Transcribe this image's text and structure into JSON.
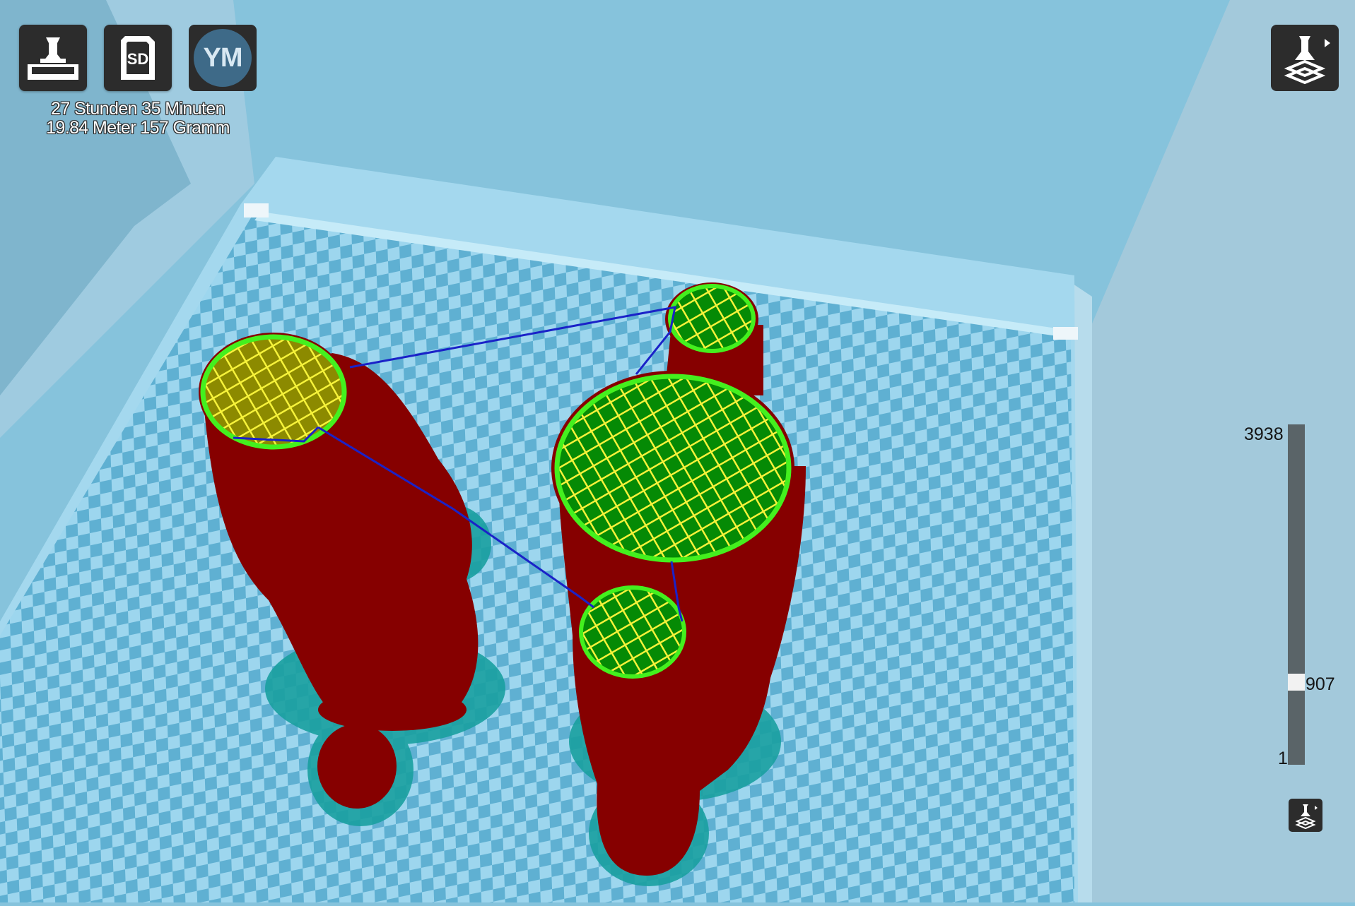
{
  "toolbar": {
    "open_file_icon": "printer-tray-icon",
    "sd_card": {
      "icon": "sd-card-icon",
      "label": "SD"
    },
    "account": {
      "initials": "YM"
    }
  },
  "print_info": {
    "duration": "27 Stunden 35 Minuten",
    "material": "19.84 Meter 157 Gramm"
  },
  "view_mode": {
    "icon": "layer-view-icon"
  },
  "layer_slider": {
    "max_label": "3938",
    "current_label": "907",
    "min_label": "1",
    "max": 3938,
    "current": 907,
    "min": 1
  },
  "colors": {
    "background": "#86c3dc",
    "bed_light": "#9dd6ee",
    "bed_dark": "#5fb0d2",
    "wall_red": "#860000",
    "infill_yellow": "#f6f23a",
    "skin_green": "#058a05",
    "outline_green": "#44f01e",
    "travel_blue": "#1a22c8",
    "brim_teal": "#1aa0a0",
    "button_dark": "#2c2c2c",
    "slider_track": "#5a6468"
  }
}
